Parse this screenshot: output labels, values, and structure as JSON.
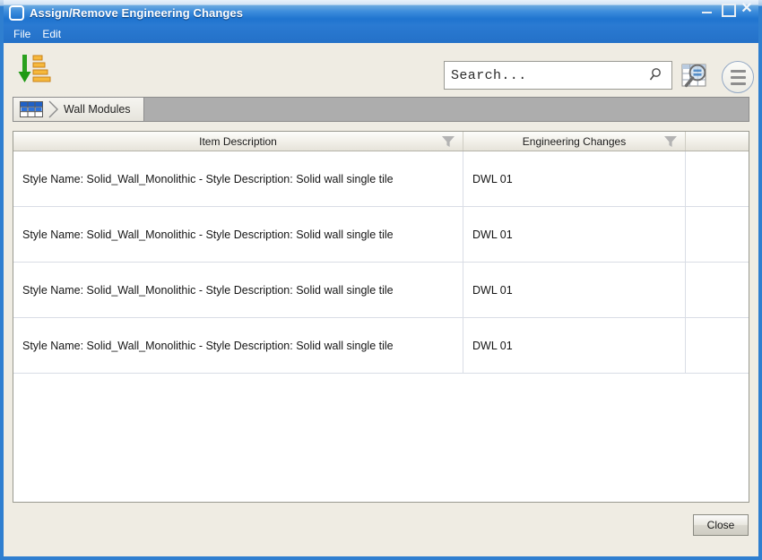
{
  "window": {
    "title": "Assign/Remove Engineering Changes",
    "app_icon": "rounded-square-icon",
    "controls": {
      "minimize": "minimize-icon",
      "maximize": "maximize-icon",
      "close": "✕"
    }
  },
  "menubar": {
    "items": [
      {
        "label": "File"
      },
      {
        "label": "Edit"
      }
    ]
  },
  "toolbar": {
    "sort_icon": "sort-descending-icon",
    "search": {
      "value": "Search...",
      "placeholder": "Search...",
      "icon": "magnifier-icon"
    },
    "grid_search_button": "grid-search-icon",
    "menu_button": "hamburger-menu-icon"
  },
  "breadcrumb": {
    "grid_icon": "table-grid-icon",
    "items": [
      {
        "label": "Wall Modules"
      }
    ]
  },
  "grid": {
    "columns": [
      {
        "header": "Item Description",
        "filter_icon": "funnel-filter-icon"
      },
      {
        "header": "Engineering Changes",
        "filter_icon": "funnel-filter-icon"
      },
      {
        "header": "",
        "filter_icon": ""
      }
    ],
    "rows": [
      {
        "item_description": "Style Name: Solid_Wall_Monolithic - Style Description: Solid wall single tile",
        "engineering_changes": "DWL 01",
        "extra": ""
      },
      {
        "item_description": "Style Name: Solid_Wall_Monolithic - Style Description: Solid wall single tile",
        "engineering_changes": "DWL 01",
        "extra": ""
      },
      {
        "item_description": "Style Name: Solid_Wall_Monolithic - Style Description: Solid wall single tile",
        "engineering_changes": "DWL 01",
        "extra": ""
      },
      {
        "item_description": "Style Name: Solid_Wall_Monolithic - Style Description: Solid wall single tile",
        "engineering_changes": "DWL 01",
        "extra": ""
      }
    ]
  },
  "footer": {
    "close_label": "Close"
  },
  "colors": {
    "titlebar_blue": "#2f7fd0",
    "frame_blue": "#2f7fd0",
    "client_beige": "#efece3",
    "breadcrumb_gray": "#adadad",
    "grid_line": "#d9dde5",
    "arrow_green": "#2aa11e",
    "bar_orange": "#f4a62a"
  }
}
